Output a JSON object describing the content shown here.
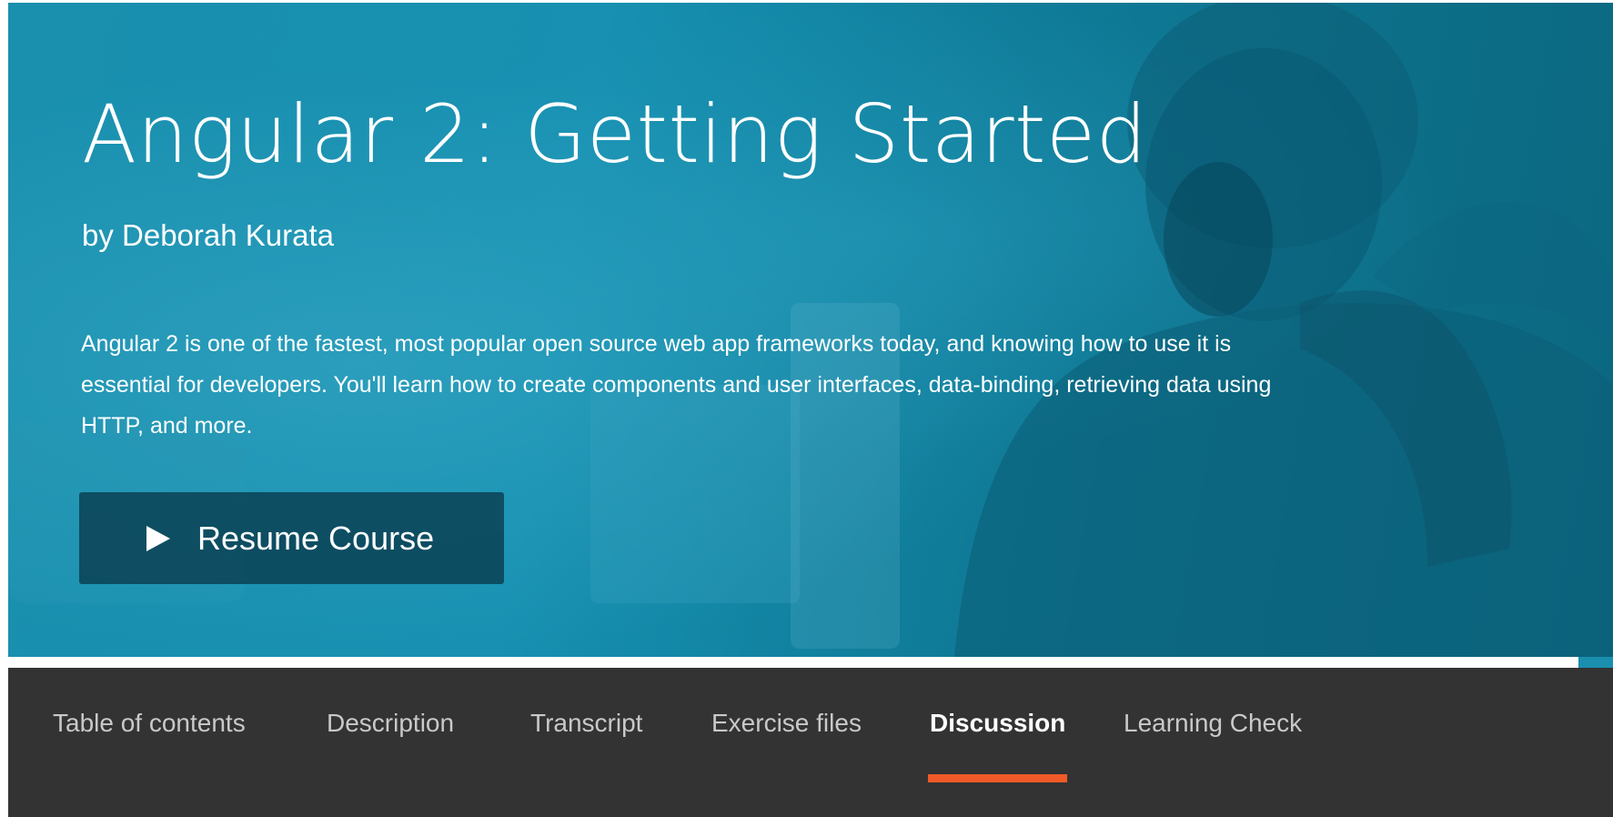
{
  "hero": {
    "title": "Angular 2: Getting Started",
    "author": "by Deborah Kurata",
    "description": "Angular 2 is one of the fastest, most popular open source web app frameworks today, and knowing how to use it is essential for developers. You'll learn how to create components and user interfaces, data-binding, retrieving data using HTTP, and more.",
    "resume_label": "Resume Course",
    "resume_icon": "play-icon"
  },
  "tabs": [
    {
      "label": "Table of contents",
      "active": false
    },
    {
      "label": "Description",
      "active": false
    },
    {
      "label": "Transcript",
      "active": false
    },
    {
      "label": "Exercise files",
      "active": false
    },
    {
      "label": "Discussion",
      "active": true
    },
    {
      "label": "Learning Check",
      "active": false
    }
  ],
  "colors": {
    "hero_teal": "#1790b1",
    "tab_bar_bg": "#333333",
    "active_tab_underline": "#f05a28",
    "button_bg": "#073242"
  }
}
